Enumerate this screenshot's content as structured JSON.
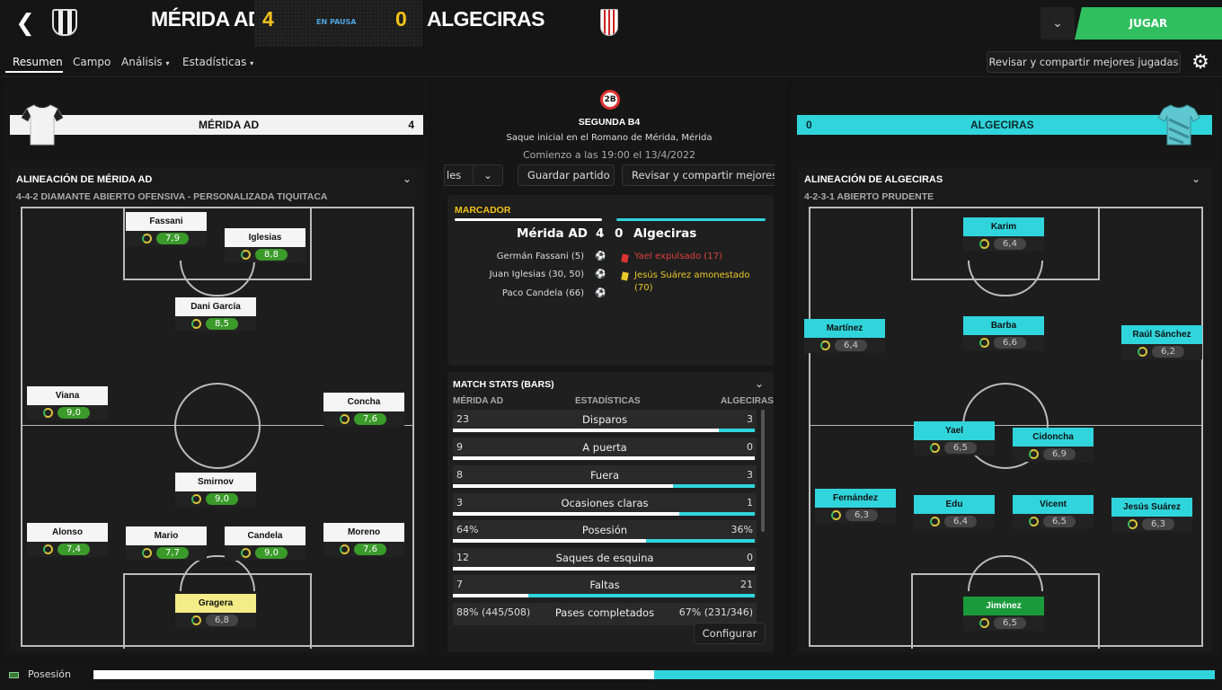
{
  "header": {
    "home_name": "MÉRIDA AD",
    "home_score": "4",
    "status": "EN PAUSA",
    "away_score": "0",
    "away_name": "ALGECIRAS",
    "play": "JUGAR"
  },
  "tabs": [
    "Resumen",
    "Campo",
    "Análisis",
    "Estadísticas"
  ],
  "review_button": "Revisar y compartir mejores jugadas",
  "home_strip": {
    "name": "MÉRIDA AD",
    "score": "4"
  },
  "away_strip": {
    "score": "0",
    "name": "ALGECIRAS"
  },
  "match_info": {
    "competition": "SEGUNDA B4",
    "venue": "Saque inicial en el Romano de Mérida, Mérida",
    "kickoff": "Comienzo a las 19:00 el 13/4/2022"
  },
  "mid_buttons": {
    "partial": "les",
    "save": "Guardar partido",
    "review": "Revisar y compartir mejores ju"
  },
  "marcador": {
    "title": "MARCADOR",
    "home": "Mérida AD",
    "hs": "4",
    "as": "0",
    "away": "Algeciras",
    "home_events": [
      "Germán Fassani (5)",
      "Juan Iglesias (30, 50)",
      "Paco Candela (66)"
    ],
    "away_events": [
      {
        "text": "Yael expulsado (17)",
        "color": "#e04040"
      },
      {
        "text": "Jesús Suárez amonestado (70)",
        "color": "#e8c92a"
      }
    ]
  },
  "stats": {
    "title": "MATCH STATS (BARS)",
    "h_home": "MÉRIDA AD",
    "h_mid": "ESTADÍSTICAS",
    "h_away": "ALGECIRAS",
    "rows": [
      {
        "l": "23",
        "c": "Disparos",
        "r": "3",
        "share": 0.88
      },
      {
        "l": "9",
        "c": "A puerta",
        "r": "0",
        "share": 1.0
      },
      {
        "l": "8",
        "c": "Fuera",
        "r": "3",
        "share": 0.73
      },
      {
        "l": "3",
        "c": "Ocasiones claras",
        "r": "1",
        "share": 0.75
      },
      {
        "l": "64%",
        "c": "Posesión",
        "r": "36%",
        "share": 0.64
      },
      {
        "l": "12",
        "c": "Saques de esquina",
        "r": "0",
        "share": 1.0
      },
      {
        "l": "7",
        "c": "Faltas",
        "r": "21",
        "share": 0.25
      },
      {
        "l": "88% (445/508)",
        "c": "Pases completados",
        "r": "67% (231/346)"
      }
    ],
    "configure": "Configurar"
  },
  "home_lineup": {
    "title": "ALINEACIÓN DE MÉRIDA AD",
    "formation": "4-4-2 DIAMANTE ABIERTO OFENSIVA - PERSONALIZADA TIQUITACA",
    "players": [
      {
        "name": "Fassani",
        "rating": "7,9",
        "good": true
      },
      {
        "name": "Iglesias",
        "rating": "8,8",
        "good": true
      },
      {
        "name": "Dani García",
        "rating": "8,5",
        "good": true
      },
      {
        "name": "Viana",
        "rating": "9,0",
        "good": true
      },
      {
        "name": "Concha",
        "rating": "7,6",
        "good": true
      },
      {
        "name": "Smirnov",
        "rating": "9,0",
        "good": true
      },
      {
        "name": "Alonso",
        "rating": "7,4",
        "good": true
      },
      {
        "name": "Mario",
        "rating": "7,7",
        "good": true
      },
      {
        "name": "Candela",
        "rating": "9,0",
        "good": true
      },
      {
        "name": "Moreno",
        "rating": "7,6",
        "good": true
      },
      {
        "name": "Gragera",
        "rating": "6,8",
        "good": false
      }
    ]
  },
  "away_lineup": {
    "title": "ALINEACIÓN DE ALGECIRAS",
    "formation": "4-2-3-1 ABIERTO PRUDENTE",
    "players": [
      {
        "name": "Karim",
        "rating": "6,4"
      },
      {
        "name": "Martínez",
        "rating": "6,4"
      },
      {
        "name": "Barba",
        "rating": "6,6"
      },
      {
        "name": "Raúl Sánchez",
        "rating": "6,2"
      },
      {
        "name": "Yael",
        "rating": "6,5"
      },
      {
        "name": "Cidoncha",
        "rating": "6,9"
      },
      {
        "name": "Fernández",
        "rating": "6,3"
      },
      {
        "name": "Edu",
        "rating": "6,4"
      },
      {
        "name": "Vicent",
        "rating": "6,5"
      },
      {
        "name": "Jesús Suárez",
        "rating": "6,3"
      },
      {
        "name": "Jiménez",
        "rating": "6,5"
      }
    ]
  },
  "possession": {
    "label": "Posesión",
    "home_share": 0.5
  },
  "colors": {
    "accent": "#30d5dc",
    "score": "#f2c21b",
    "play": "#2fbf5f"
  }
}
